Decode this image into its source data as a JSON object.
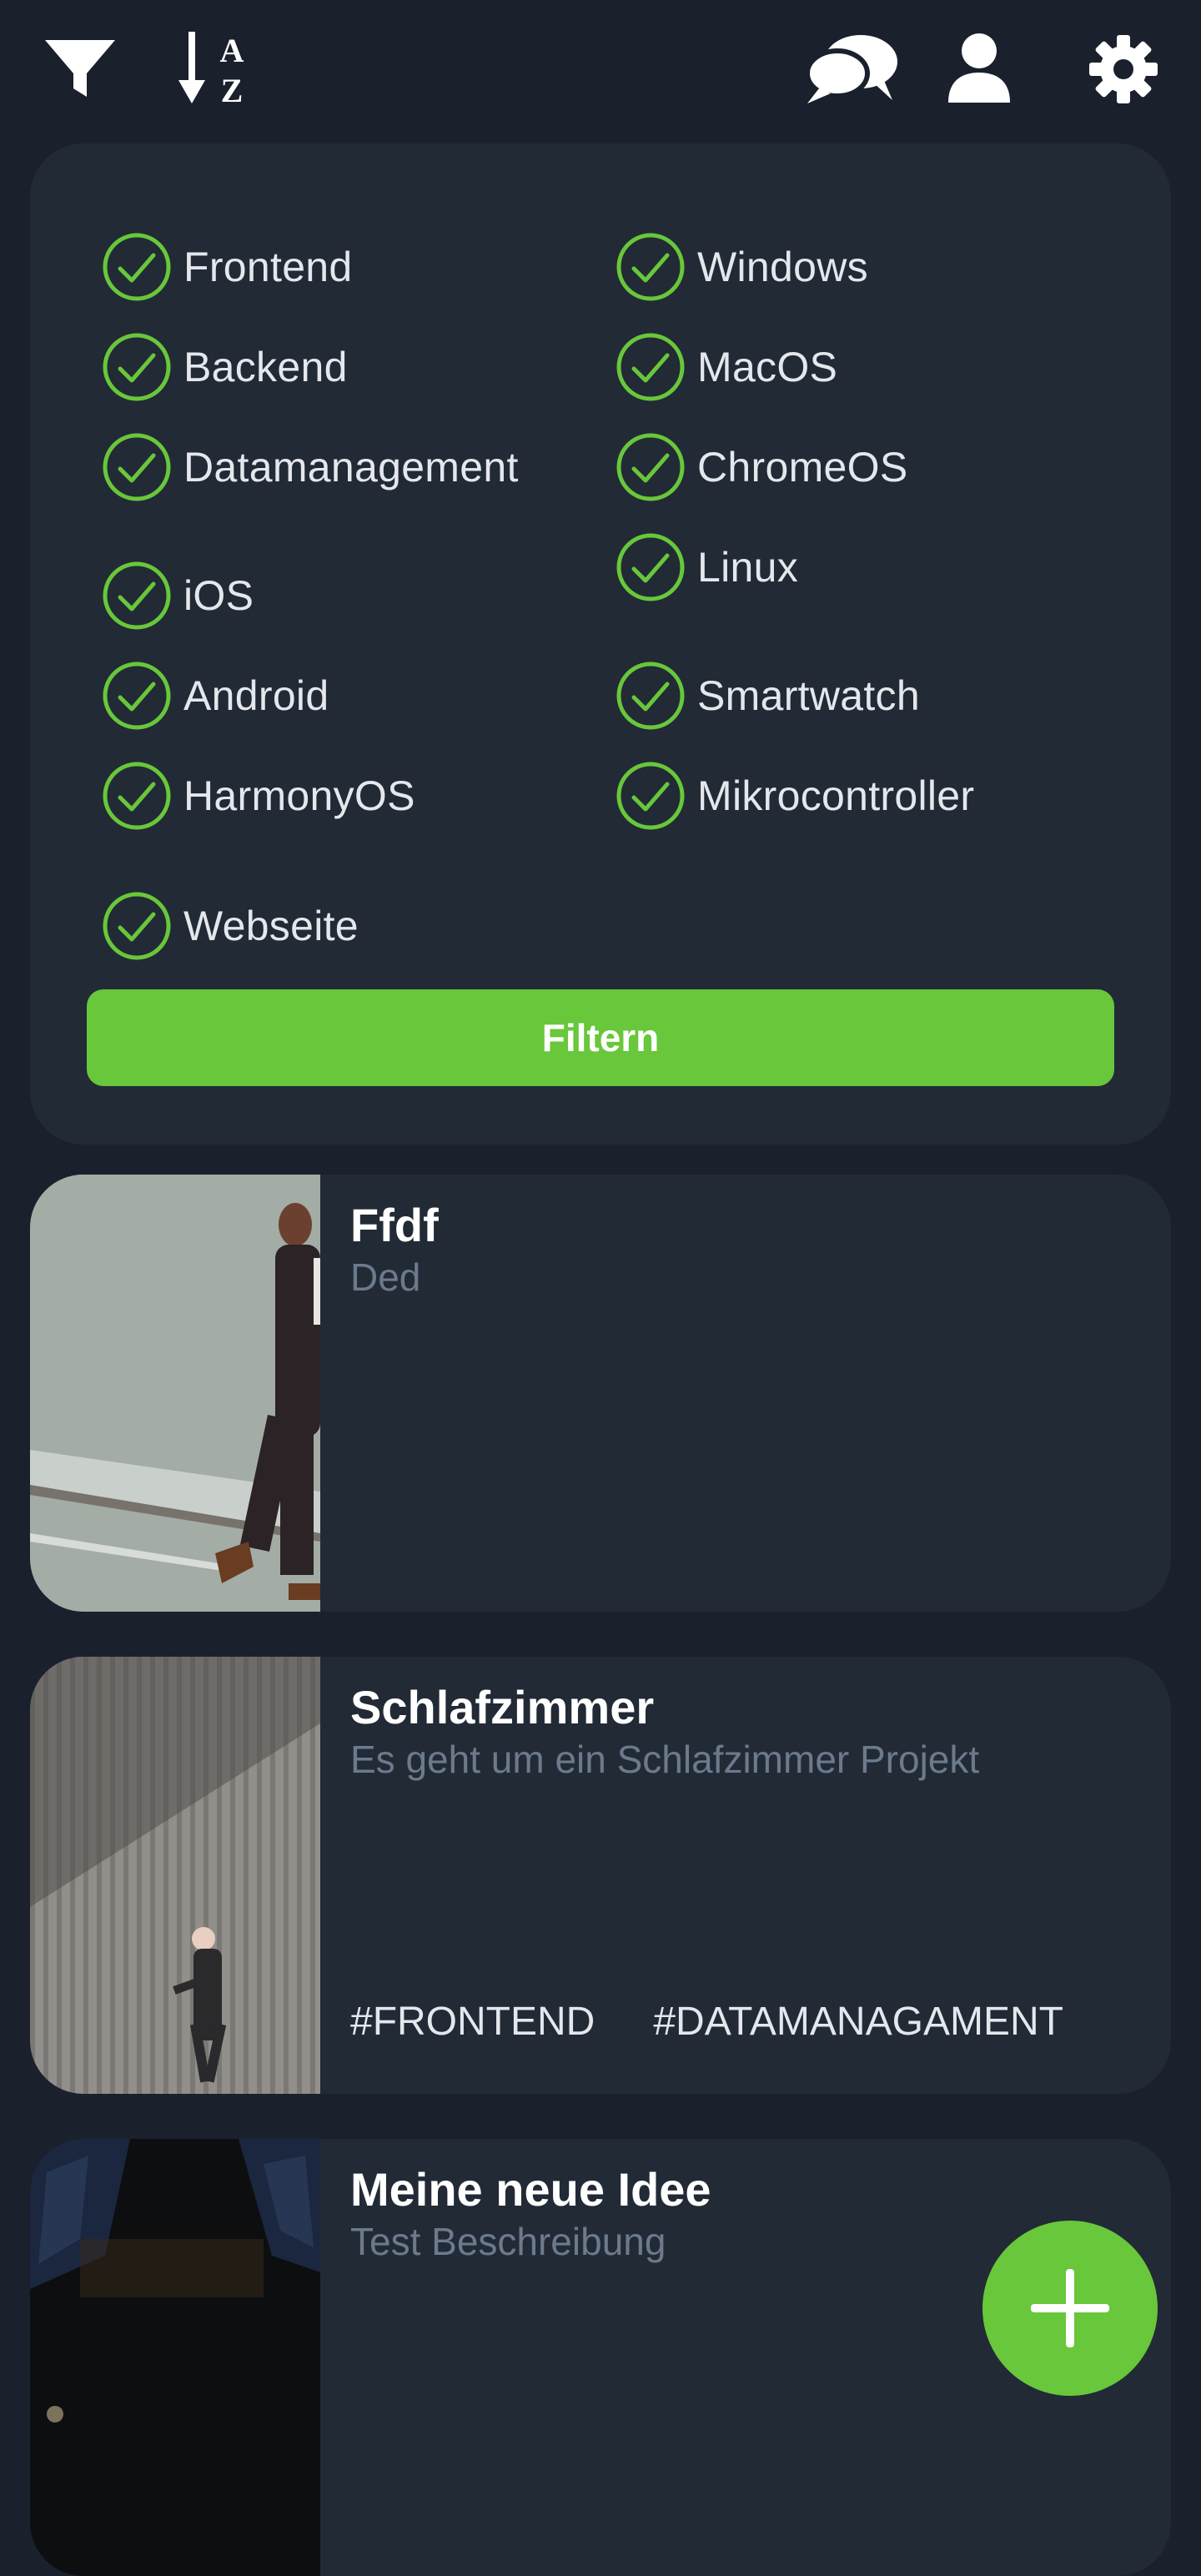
{
  "toolbar": {
    "filter_icon": "funnel-icon",
    "sort_icon": "sort-alpha-down-icon",
    "sort_letter_top": "A",
    "sort_letter_bottom": "Z",
    "chat_icon": "chat-bubbles-icon",
    "profile_icon": "user-icon",
    "settings_icon": "gear-icon"
  },
  "filter": {
    "accent_color": "#68c73a",
    "left_options": [
      {
        "label": "Frontend",
        "checked": true
      },
      {
        "label": "Backend",
        "checked": true
      },
      {
        "label": "Datamanagement",
        "checked": true
      },
      {
        "label": "iOS",
        "checked": true
      },
      {
        "label": "Android",
        "checked": true
      },
      {
        "label": "HarmonyOS",
        "checked": true
      },
      {
        "label": "Webseite",
        "checked": true
      }
    ],
    "right_options": [
      {
        "label": "Windows",
        "checked": true
      },
      {
        "label": "MacOS",
        "checked": true
      },
      {
        "label": "ChromeOS",
        "checked": true
      },
      {
        "label": "Linux",
        "checked": true
      },
      {
        "label": "Smartwatch",
        "checked": true
      },
      {
        "label": "Mikrocontroller",
        "checked": true
      }
    ],
    "button_label": "Filtern"
  },
  "ideas": [
    {
      "title": "Ffdf",
      "description": "Ded",
      "tags": []
    },
    {
      "title": "Schlafzimmer",
      "description": "Es geht um ein Schlafzimmer Projekt",
      "tags": [
        "#FRONTEND",
        "#DATAMANAGAMENT"
      ]
    },
    {
      "title": "Meine neue Idee",
      "description": "Test Beschreibung",
      "tags": []
    }
  ],
  "fab": {
    "icon": "plus-icon"
  }
}
